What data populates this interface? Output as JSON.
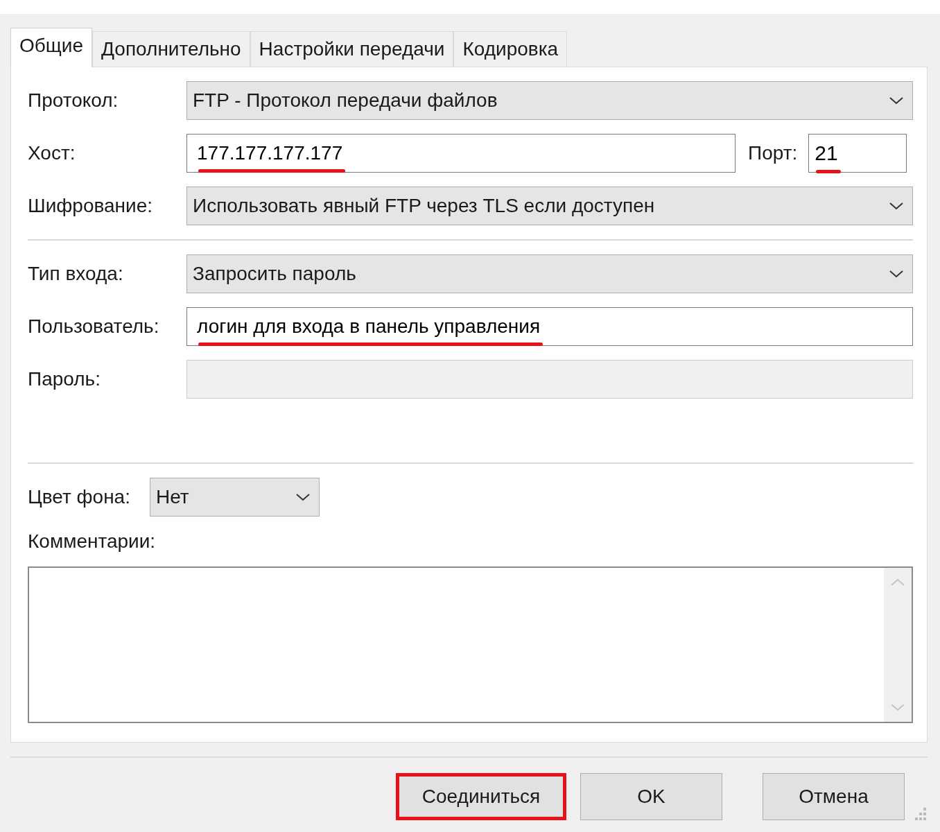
{
  "tabs": [
    {
      "label": "Общие",
      "selected": true
    },
    {
      "label": "Дополнительно",
      "selected": false
    },
    {
      "label": "Настройки передачи",
      "selected": false
    },
    {
      "label": "Кодировка",
      "selected": false
    }
  ],
  "protocol": {
    "label": "Протокол:",
    "value": "FTP - Протокол передачи файлов"
  },
  "host": {
    "label": "Хост:",
    "value": "177.177.177.177",
    "highlighted": true
  },
  "port": {
    "label": "Порт:",
    "value": "21",
    "highlighted": true
  },
  "encryption": {
    "label": "Шифрование:",
    "value": "Использовать явный FTP через TLS если доступен"
  },
  "logon_type": {
    "label": "Тип входа:",
    "value": "Запросить пароль"
  },
  "user": {
    "label": "Пользователь:",
    "value": "логин для входа в панель управления",
    "highlighted": true
  },
  "password": {
    "label": "Пароль:",
    "disabled": true
  },
  "background_color": {
    "label": "Цвет фона:",
    "value": "Нет"
  },
  "comments": {
    "label": "Комментарии:"
  },
  "buttons": [
    {
      "label": "Соединиться",
      "highlighted": true
    },
    {
      "label": "OK",
      "highlighted": false
    },
    {
      "label": "Отмена",
      "highlighted": false
    }
  ]
}
